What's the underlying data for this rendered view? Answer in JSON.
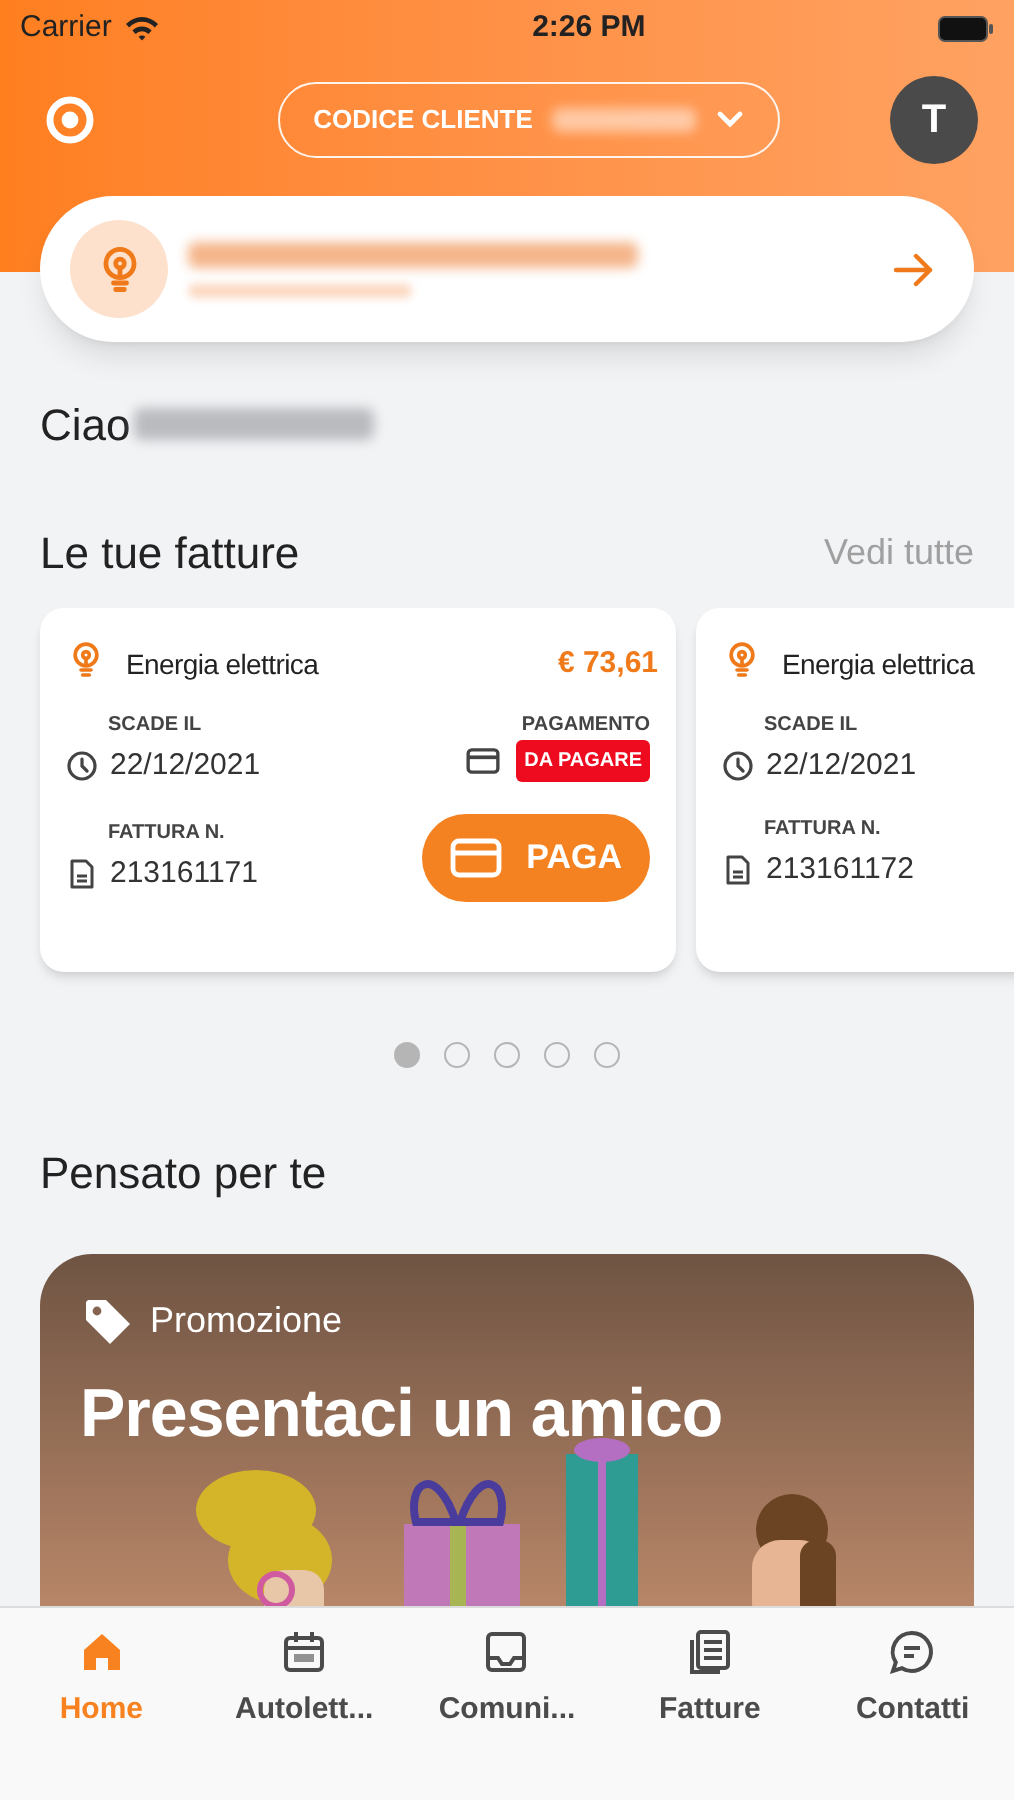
{
  "status_bar": {
    "carrier": "Carrier",
    "time": "2:26 PM"
  },
  "header": {
    "customer_code_label": "CODICE CLIENTE",
    "avatar": "T"
  },
  "greeting": "Ciao",
  "invoices": {
    "title": "Le tue fatture",
    "see_all": "Vedi tutte",
    "items": [
      {
        "type": "Energia elettrica",
        "amount": "€ 73,61",
        "due_label": "SCADE IL",
        "due_date": "22/12/2021",
        "payment_label": "PAGAMENTO",
        "payment_status": "DA PAGARE",
        "invoice_label": "FATTURA N.",
        "invoice_number": "213161171",
        "pay_button": "PAGA"
      },
      {
        "type": "Energia elettrica",
        "due_label": "SCADE IL",
        "due_date": "22/12/2021",
        "invoice_label": "FATTURA N.",
        "invoice_number": "213161172"
      }
    ]
  },
  "pager": [
    {
      "selected": true
    },
    {
      "selected": false
    },
    {
      "selected": false
    },
    {
      "selected": false
    },
    {
      "selected": false
    }
  ],
  "suggestions": {
    "title": "Pensato per te",
    "promo": {
      "tag": "Promozione",
      "title": "Presentaci un amico"
    }
  },
  "tab_bar": [
    {
      "label": "Home",
      "kind": "home",
      "selected": true
    },
    {
      "label": "Autolett...",
      "kind": "calendar",
      "selected": false
    },
    {
      "label": "Comuni...",
      "kind": "inbox",
      "selected": false
    },
    {
      "label": "Fatture",
      "kind": "document",
      "selected": false
    },
    {
      "label": "Contatti",
      "kind": "chat",
      "selected": false
    }
  ]
}
